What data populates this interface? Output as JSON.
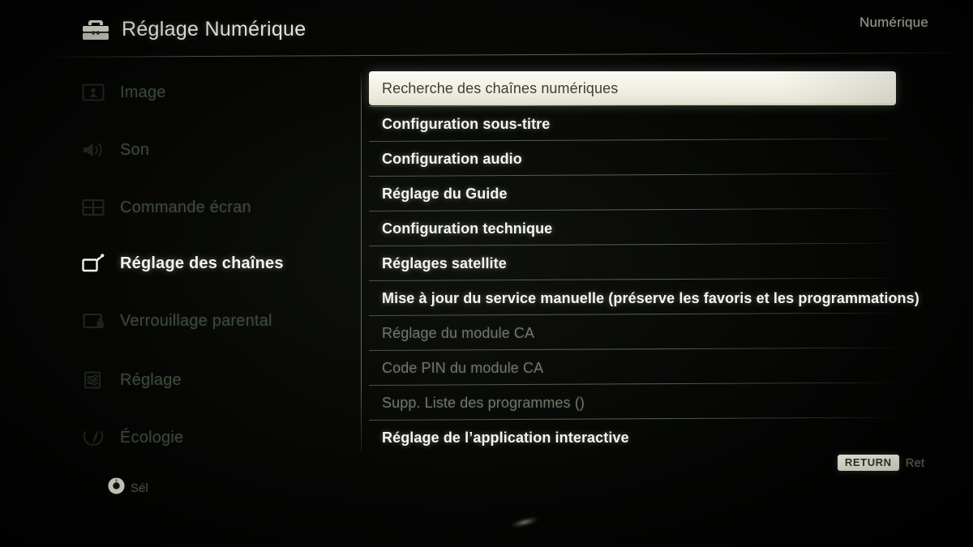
{
  "header": {
    "icon": "toolbox-icon",
    "title": "Réglage Numérique",
    "mode_label": "Numérique"
  },
  "sidebar": {
    "items": [
      {
        "label": "Image",
        "icon": "picture-icon",
        "state": "dim"
      },
      {
        "label": "Son",
        "icon": "speaker-icon",
        "state": "dim"
      },
      {
        "label": "Commande écran",
        "icon": "screen-grid-icon",
        "state": "dim"
      },
      {
        "label": "Réglage des chaînes",
        "icon": "tv-antenna-icon",
        "state": "active"
      },
      {
        "label": "Verrouillage parental",
        "icon": "screen-lock-icon",
        "state": "dim"
      },
      {
        "label": "Réglage",
        "icon": "list-settings-icon",
        "state": "dim"
      },
      {
        "label": "Écologie",
        "icon": "leaf-eco-icon",
        "state": "dim"
      }
    ],
    "select_hint": {
      "icon": "ok-button-icon",
      "label": "Sél"
    }
  },
  "menu": {
    "items": [
      {
        "label": "Recherche des chaînes numériques",
        "state": "selected"
      },
      {
        "label": "Configuration sous-titre",
        "state": "normal"
      },
      {
        "label": "Configuration audio",
        "state": "normal"
      },
      {
        "label": "Réglage du Guide",
        "state": "normal"
      },
      {
        "label": "Configuration technique",
        "state": "normal"
      },
      {
        "label": "Réglages satellite",
        "state": "normal"
      },
      {
        "label": "Mise à jour du service manuelle (préserve les favoris et les programmations)",
        "state": "normal"
      },
      {
        "label": "Réglage du module CA",
        "state": "disabled"
      },
      {
        "label": "Code PIN du module CA",
        "state": "disabled"
      },
      {
        "label": "Supp. Liste des programmes ()",
        "state": "disabled"
      },
      {
        "label": "Réglage de l’application interactive",
        "state": "normal"
      }
    ]
  },
  "footer": {
    "return_key": "RETURN",
    "return_label": "Ret"
  },
  "colors": {
    "background": "#000000",
    "highlight_fill": "#f3f2e6",
    "highlight_text": "#3b3d36",
    "active_text": "#f2f3ec",
    "dim_text": "#3e4a3c",
    "disabled_text": "#6e7569",
    "divider": "#a5bea0"
  }
}
